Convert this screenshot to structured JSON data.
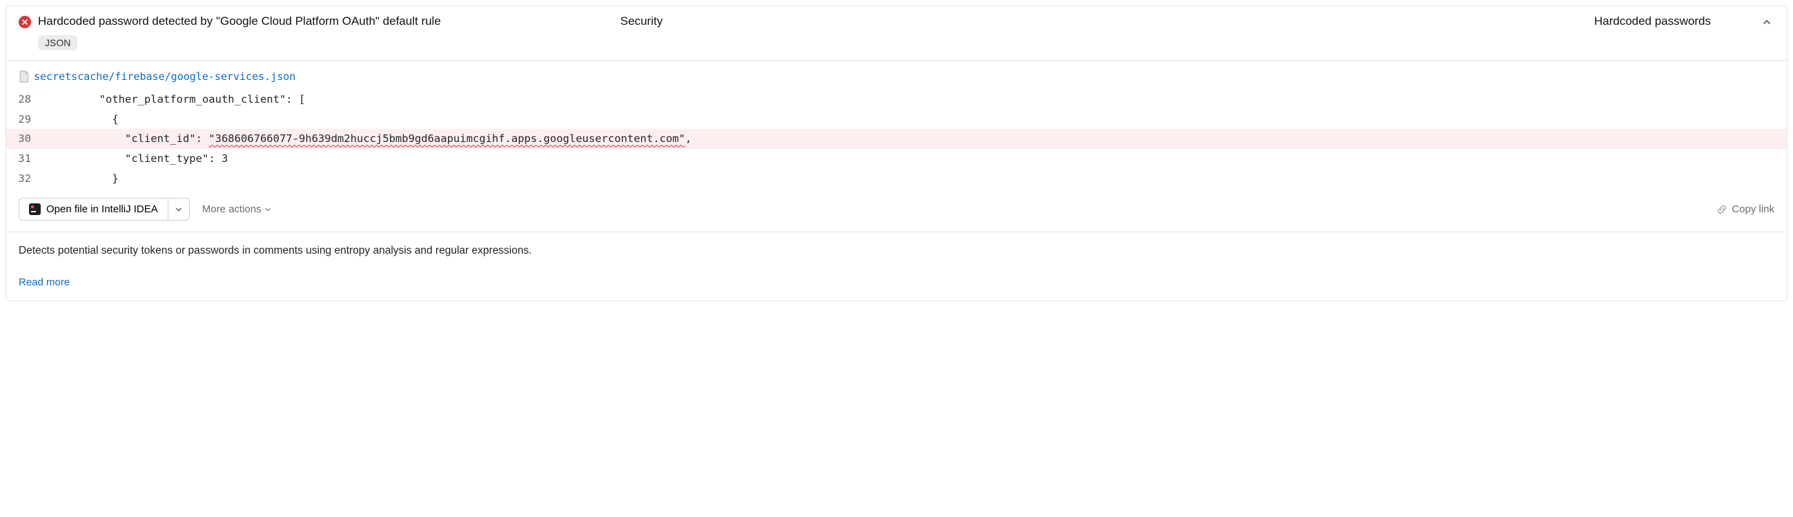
{
  "header": {
    "title": "Hardcoded password detected by \"Google Cloud Platform OAuth\" default rule",
    "category": "Security",
    "subcategory": "Hardcoded passwords",
    "tag": "JSON"
  },
  "file": {
    "path": "secretscache/firebase/google-services.json"
  },
  "code": {
    "lines": [
      {
        "num": "28",
        "text": "        \"other_platform_oauth_client\": [",
        "hl": false
      },
      {
        "num": "29",
        "text": "          {",
        "hl": false
      },
      {
        "num": "30",
        "prefix": "            \"client_id\": ",
        "squiggle": "\"368606766077-9h639dm2huccj5bmb9gd6aapuimcgihf.apps.googleusercontent.com\"",
        "suffix": ",",
        "hl": true
      },
      {
        "num": "31",
        "text": "            \"client_type\": 3",
        "hl": false
      },
      {
        "num": "32",
        "text": "          }",
        "hl": false
      }
    ]
  },
  "actions": {
    "open_ide": "Open file in IntelliJ IDEA",
    "more": "More actions",
    "copy": "Copy link"
  },
  "description": "Detects potential security tokens or passwords in comments using entropy analysis and regular expressions.",
  "read_more": "Read more"
}
